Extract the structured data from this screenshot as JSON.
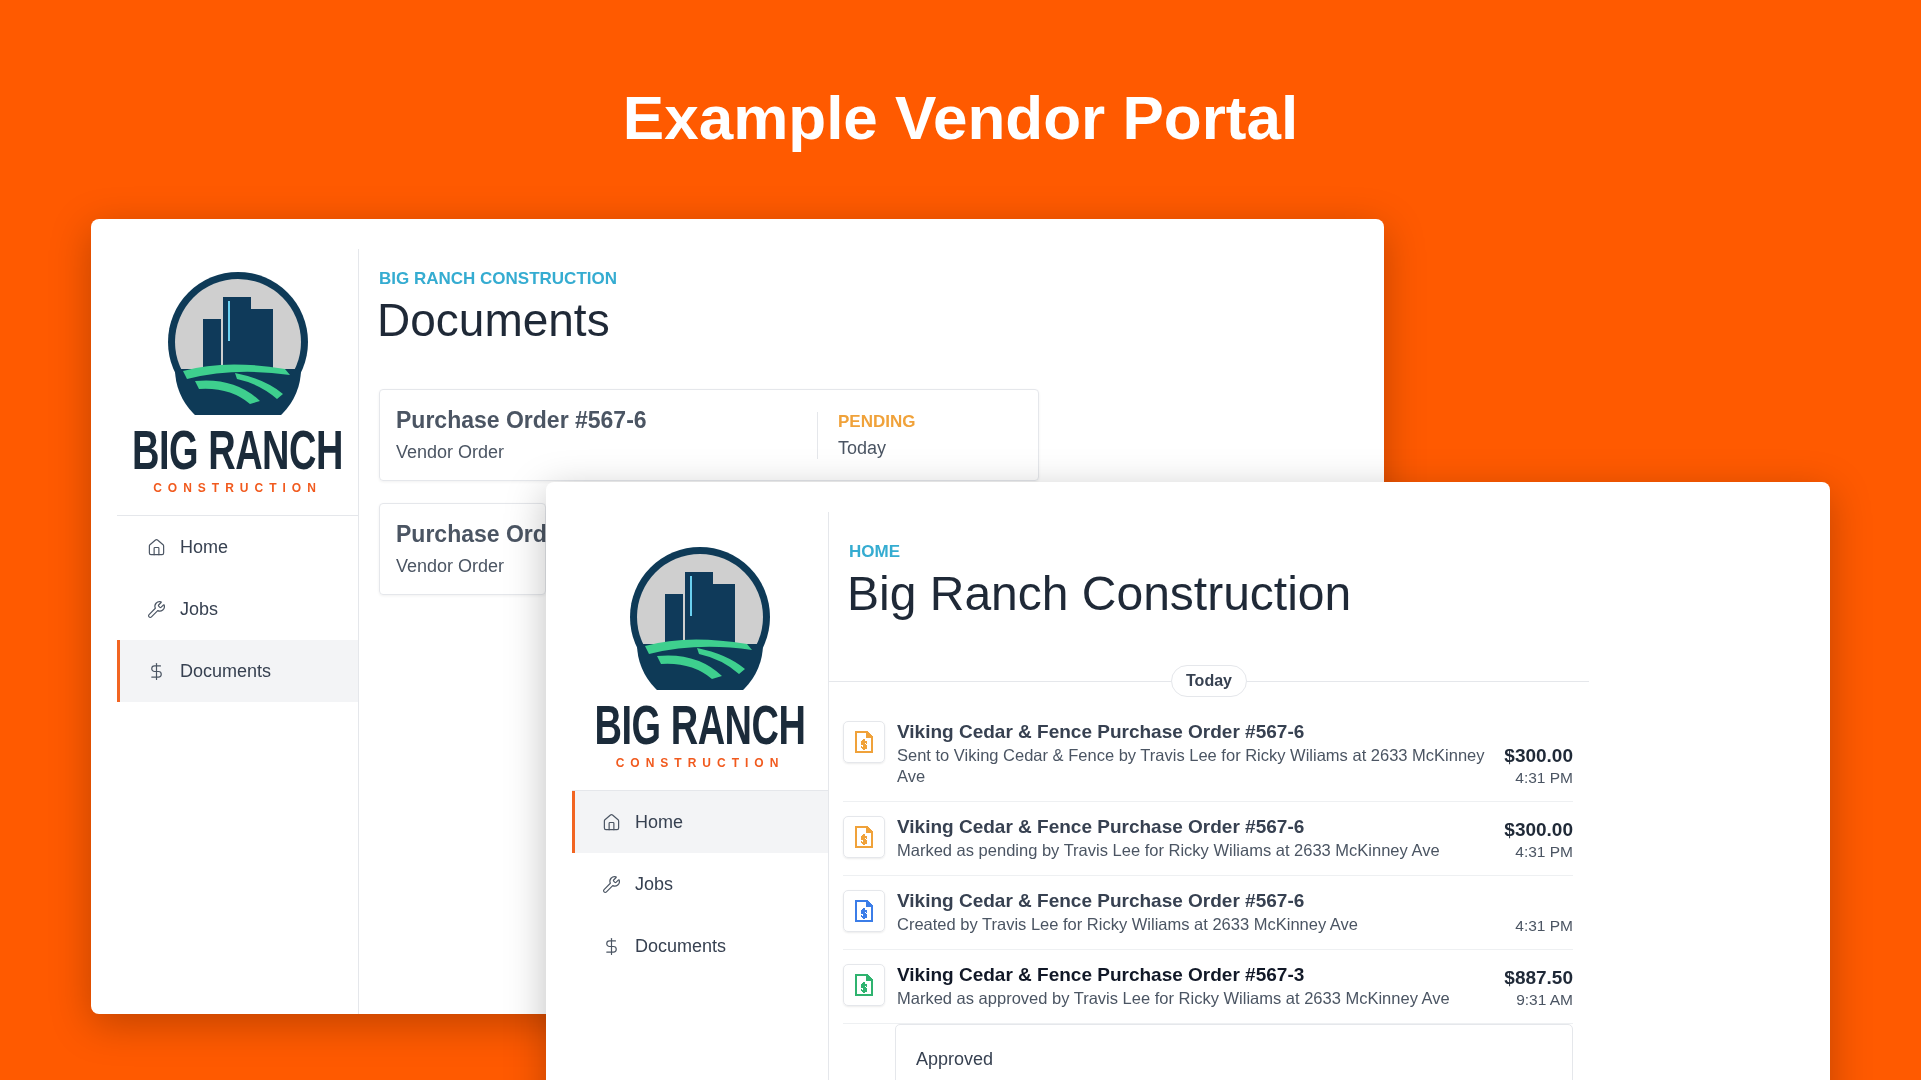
{
  "page_title": "Example Vendor Portal",
  "back_window": {
    "logo": {
      "name": "BIG RANCH",
      "tagline": "CONSTRUCTION"
    },
    "nav": [
      {
        "label": "Home",
        "selected": false
      },
      {
        "label": "Jobs",
        "selected": false
      },
      {
        "label": "Documents",
        "selected": true
      }
    ],
    "breadcrumb": "BIG RANCH CONSTRUCTION",
    "title": "Documents",
    "documents": [
      {
        "title": "Purchase Order #567-6",
        "subtitle": "Vendor Order",
        "status": "PENDING",
        "date": "Today"
      },
      {
        "title": "Purchase Ord",
        "subtitle": "Vendor Order"
      }
    ]
  },
  "front_window": {
    "logo": {
      "name": "BIG RANCH",
      "tagline": "CONSTRUCTION"
    },
    "nav": [
      {
        "label": "Home",
        "selected": true
      },
      {
        "label": "Jobs",
        "selected": false
      },
      {
        "label": "Documents",
        "selected": false
      }
    ],
    "breadcrumb": "HOME",
    "title": "Big Ranch Construction",
    "day_label": "Today",
    "activity": [
      {
        "title": "Viking Cedar & Fence Purchase Order #567-6",
        "description": "Sent to Viking Cedar & Fence by Travis Lee for Ricky Wiliams at 2633 McKinney Ave",
        "amount": "$300.00",
        "time": "4:31 PM",
        "color": "#f0a23a",
        "unread": false
      },
      {
        "title": "Viking Cedar & Fence Purchase Order #567-6",
        "description": "Marked as pending by Travis Lee for Ricky Wiliams at 2633 McKinney Ave",
        "amount": "$300.00",
        "time": "4:31 PM",
        "color": "#f0a23a",
        "unread": false
      },
      {
        "title": "Viking Cedar & Fence Purchase Order #567-6",
        "description": "Created by Travis Lee for Ricky Wiliams at 2633 McKinney Ave",
        "time": "4:31 PM",
        "color": "#3b7de8",
        "unread": false
      },
      {
        "title": "Viking Cedar & Fence Purchase Order #567-3",
        "description": "Marked as approved by Travis Lee for Ricky Wiliams at 2633 McKinney Ave",
        "amount": "$887.50",
        "time": "9:31 AM",
        "color": "#2fb36f",
        "unread": true
      }
    ],
    "note": "Approved"
  }
}
